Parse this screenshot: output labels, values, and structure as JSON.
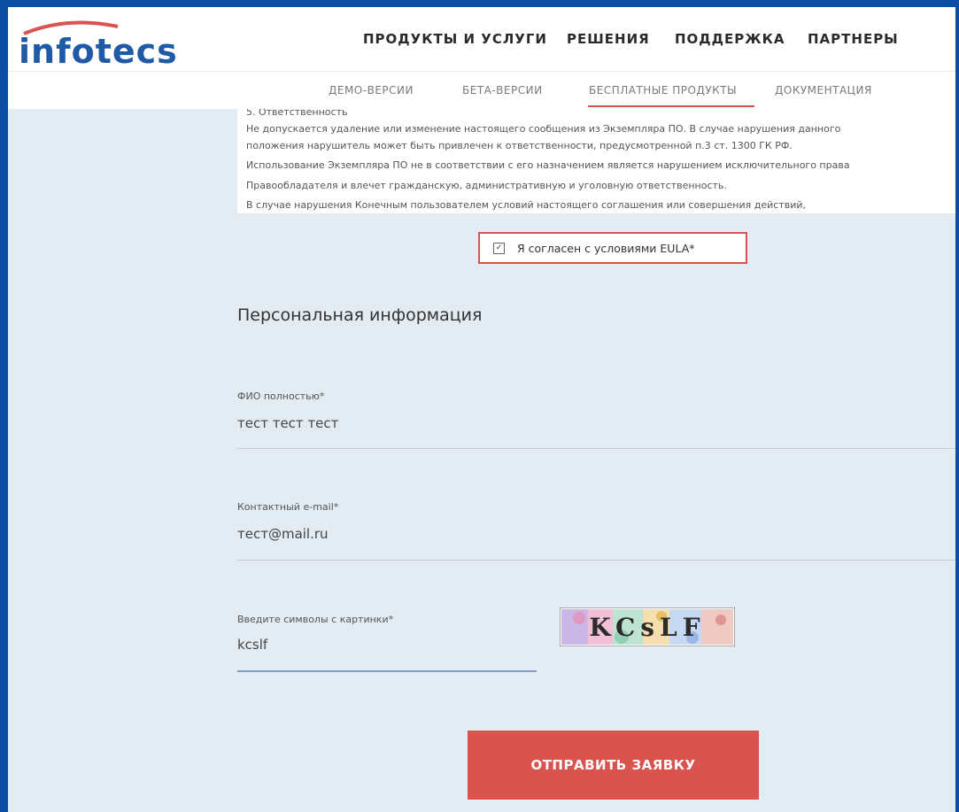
{
  "header": {
    "logo_text": "infotecs",
    "nav": [
      "ПРОДУКТЫ И УСЛУГИ",
      "РЕШЕНИЯ",
      "ПОДДЕРЖКА",
      "ПАРТНЕРЫ"
    ]
  },
  "subnav": {
    "items": [
      "ДЕМО-ВЕРСИИ",
      "БЕТА-ВЕРСИИ",
      "БЕСПЛАТНЫЕ ПРОДУКТЫ",
      "ДОКУМЕНТАЦИЯ"
    ],
    "active_index": 2
  },
  "eula": {
    "lines": [
      "5. Ответственность",
      "Не допускается удаление или изменение настоящего сообщения из Экземпляра ПО. В случае нарушения данного",
      "положения нарушитель может быть привлечен к ответственности, предусмотренной п.3 ст. 1300 ГК РФ.",
      "Использование Экземпляра ПО не в соответствии с его назначением является нарушением исключительного права",
      "Правообладателя и влечет гражданскую, административную и уголовную ответственность.",
      "В случае нарушения Конечным пользователем условий настоящего соглашения или совершения действий,"
    ]
  },
  "agree": {
    "label": "Я согласен с условиями EULA*",
    "checked": true
  },
  "section_title": "Персональная информация",
  "fields": {
    "name": {
      "label": "ФИО полностью*",
      "value": "тест тест тест"
    },
    "email": {
      "label": "Контактный e-mail*",
      "value": "тест@mail.ru"
    },
    "captcha": {
      "label": "Введите символы с картинки*",
      "value": "kcslf",
      "image_text": "KCsLF"
    }
  },
  "submit": {
    "label": "ОТПРАВИТЬ ЗАЯВКУ"
  },
  "colors": {
    "brand_blue": "#1f5aa6",
    "accent_red": "#d9534f",
    "content_bg": "#e3ecf3"
  }
}
